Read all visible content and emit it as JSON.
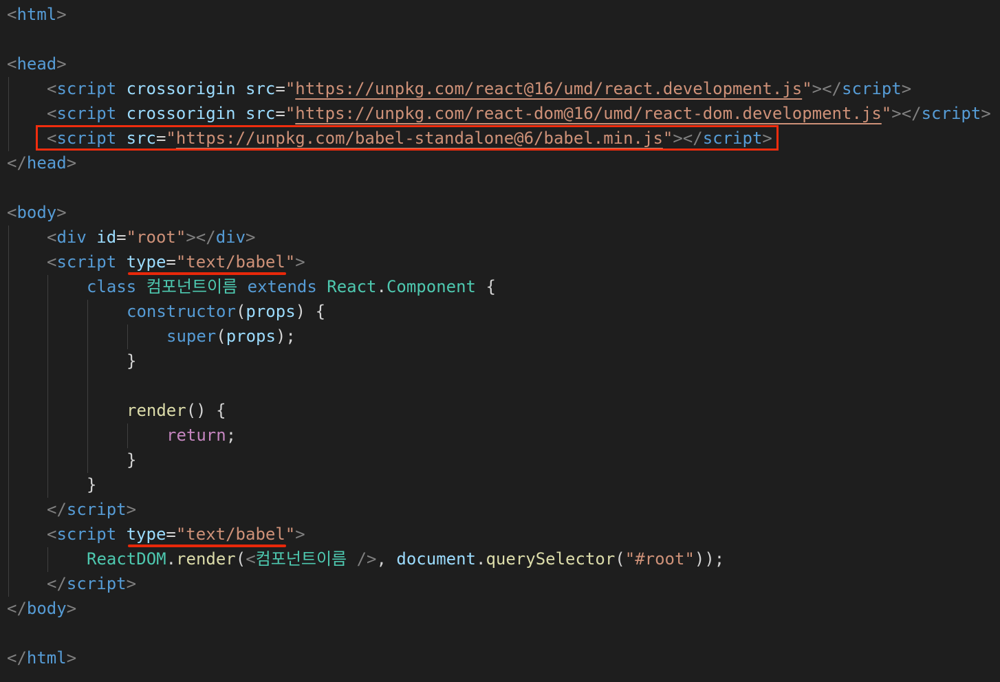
{
  "editor": {
    "lines": {
      "html_open": {
        "lt": "<",
        "tag": "html",
        "gt": ">"
      },
      "head_open": {
        "lt": "<",
        "tag": "head",
        "gt": ">"
      },
      "script1": {
        "lt": "<",
        "tag": "script",
        "attr1": "crossorigin",
        "attr2": "src",
        "eq": "=",
        "q1": "\"",
        "url": "https://unpkg.com/react@16/umd/react.development.js",
        "q2": "\"",
        "mid": "></",
        "close_tag": "script",
        "gt": ">"
      },
      "script2": {
        "lt": "<",
        "tag": "script",
        "attr1": "crossorigin",
        "attr2": "src",
        "eq": "=",
        "q1": "\"",
        "url": "https://unpkg.com/react-dom@16/umd/react-dom.development.js",
        "q2": "\"",
        "mid": "></",
        "close_tag": "script",
        "gt": ">"
      },
      "script3": {
        "lt": "<",
        "tag": "script",
        "attr": "src",
        "eq": "=",
        "q1": "\"",
        "url": "https://unpkg.com/babel-standalone@6/babel.min.js",
        "q2": "\"",
        "mid": "></",
        "close_tag": "script",
        "gt": ">"
      },
      "head_close": {
        "lt": "</",
        "tag": "head",
        "gt": ">"
      },
      "body_open": {
        "lt": "<",
        "tag": "body",
        "gt": ">"
      },
      "div_root": {
        "lt": "<",
        "tag": "div",
        "attr": "id",
        "eq": "=",
        "value": "\"root\"",
        "mid": "></",
        "close_tag": "div",
        "gt": ">"
      },
      "script_babel_1": {
        "lt": "<",
        "tag": "script",
        "attr": "type",
        "eq": "=",
        "value": "\"text/babel\"",
        "gt": ">"
      },
      "class_decl": {
        "kw_class": "class",
        "name": "컴포넌트이름",
        "kw_extends": "extends",
        "base_obj": "React",
        "dot": ".",
        "base_cls": "Component",
        "brace": "{"
      },
      "constructor": {
        "name": "constructor",
        "open": "(",
        "param": "props",
        "close": ")",
        "brace": "{"
      },
      "super_call": {
        "name": "super",
        "open": "(",
        "arg": "props",
        "close": ");"
      },
      "constructor_close": {
        "brace": "}"
      },
      "render": {
        "name": "render",
        "parens": "()",
        "brace": "{"
      },
      "return_stmt": {
        "kw": "return",
        "semi": ";"
      },
      "render_close": {
        "brace": "}"
      },
      "class_close": {
        "brace": "}"
      },
      "script_close_1": {
        "lt": "</",
        "tag": "script",
        "gt": ">"
      },
      "script_babel_2": {
        "lt": "<",
        "tag": "script",
        "attr": "type",
        "eq": "=",
        "value": "\"text/babel\"",
        "gt": ">"
      },
      "reactdom_render": {
        "obj": "ReactDOM",
        "dot": ".",
        "fn": "render",
        "open": "(",
        "jsx_lt": "<",
        "jsx_tag": "컴포넌트이름",
        "jsx_close": " />",
        "comma": ", ",
        "doc": "document",
        "dot2": ".",
        "qs": "querySelector",
        "open2": "(",
        "sel": "\"#root\"",
        "end": "));"
      },
      "script_close_2": {
        "lt": "</",
        "tag": "script",
        "gt": ">"
      },
      "body_close": {
        "lt": "</",
        "tag": "body",
        "gt": ">"
      },
      "html_close": {
        "lt": "</",
        "tag": "html",
        "gt": ">"
      }
    },
    "annotation_color": "#f12d0e"
  }
}
